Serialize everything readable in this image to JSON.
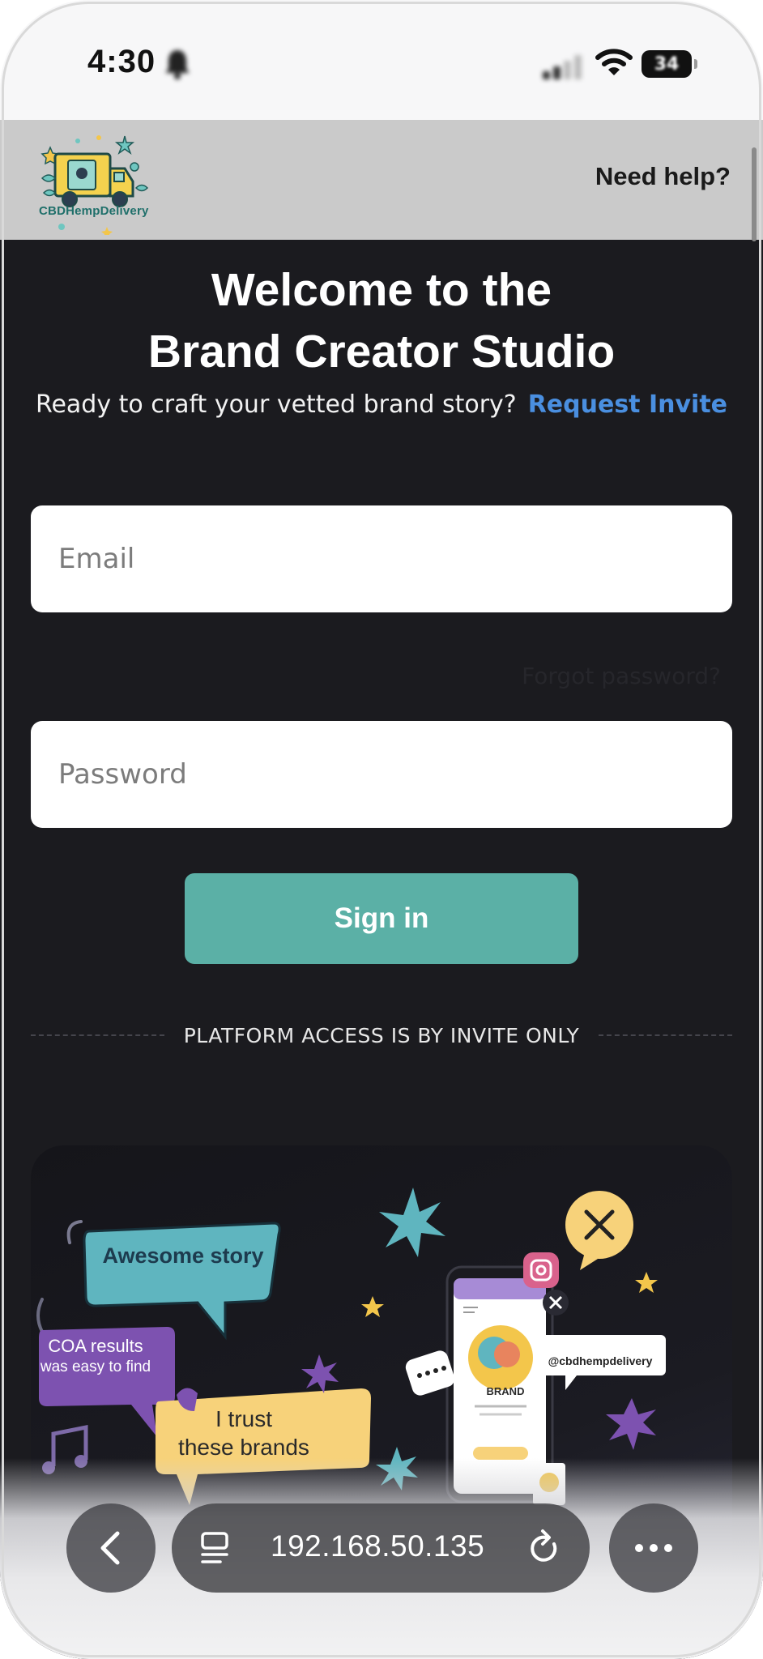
{
  "status_bar": {
    "time": "4:30",
    "battery": "34"
  },
  "header": {
    "logo_text": "CBDHempDelivery",
    "help_label": "Need help?"
  },
  "login": {
    "title_line1": "Welcome to the",
    "title_line2": "Brand Creator Studio",
    "subtitle": "Ready to craft your vetted brand story?",
    "request_invite_label": "Request Invite",
    "email_placeholder": "Email",
    "forgot_password_label": "Forgot password?",
    "password_placeholder": "Password",
    "sign_in_label": "Sign in",
    "invite_only_notice": "PLATFORM ACCESS IS BY INVITE ONLY"
  },
  "promo": {
    "bubble_1": "Awesome story",
    "bubble_2_line1": "COA results",
    "bubble_2_line2": "was easy to find",
    "bubble_3_line1": "I trust",
    "bubble_3_line2": "these brands",
    "handle": "@cbdhempdelivery",
    "brand_label": "BRAND"
  },
  "browser": {
    "url": "192.168.50.135"
  },
  "colors": {
    "page_background": "#1b1b1f",
    "header_background": "#cacaca",
    "accent_link": "#4a8fe0",
    "primary_button": "#5bb0a6"
  }
}
